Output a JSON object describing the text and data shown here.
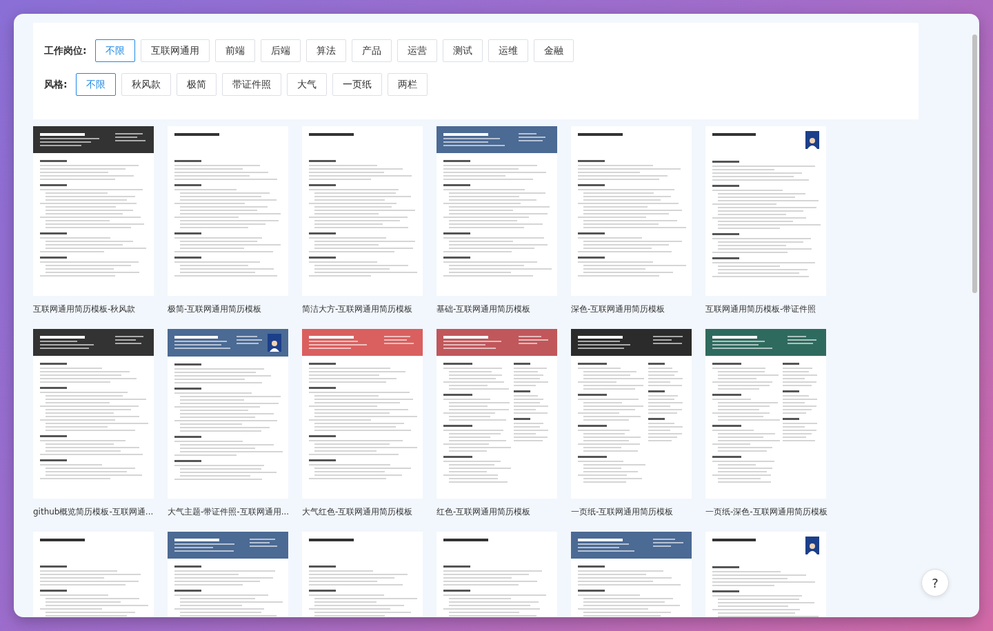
{
  "filters": [
    {
      "label": "工作岗位:",
      "options": [
        {
          "text": "不限",
          "selected": true
        },
        {
          "text": "互联网通用",
          "selected": false
        },
        {
          "text": "前端",
          "selected": false
        },
        {
          "text": "后端",
          "selected": false
        },
        {
          "text": "算法",
          "selected": false
        },
        {
          "text": "产品",
          "selected": false
        },
        {
          "text": "运营",
          "selected": false
        },
        {
          "text": "测试",
          "selected": false
        },
        {
          "text": "运维",
          "selected": false
        },
        {
          "text": "金融",
          "selected": false
        }
      ]
    },
    {
      "label": "风格:",
      "options": [
        {
          "text": "不限",
          "selected": true
        },
        {
          "text": "秋风款",
          "selected": false
        },
        {
          "text": "极简",
          "selected": false
        },
        {
          "text": "带证件照",
          "selected": false
        },
        {
          "text": "大气",
          "selected": false
        },
        {
          "text": "一页纸",
          "selected": false
        },
        {
          "text": "两栏",
          "selected": false
        }
      ]
    }
  ],
  "templates": [
    {
      "title": "互联网通用简历模板-秋风款",
      "kind": "single",
      "color": "#333333",
      "photo": false
    },
    {
      "title": "极简-互联网通用简历模板",
      "kind": "single",
      "photo": false
    },
    {
      "title": "简洁大方-互联网通用简历模板",
      "kind": "single",
      "photo": false
    },
    {
      "title": "基础-互联网通用简历模板",
      "kind": "single",
      "color": "#4b6a94",
      "photo": false
    },
    {
      "title": "深色-互联网通用简历模板",
      "kind": "single",
      "photo": false
    },
    {
      "title": "互联网通用简历模板-带证件照",
      "kind": "single",
      "photo": true
    },
    {
      "title": "github概览简历模板-互联网通...",
      "kind": "single",
      "color": "#333333",
      "photo": false
    },
    {
      "title": "大气主题-带证件照-互联网通用...",
      "kind": "single",
      "color": "#4b6a94",
      "photo": true
    },
    {
      "title": "大气红色-互联网通用简历模板",
      "kind": "single",
      "color": "#d9605f",
      "photo": false
    },
    {
      "title": "红色-互联网通用简历模板",
      "kind": "two-column",
      "color": "#c0575b",
      "photo": false
    },
    {
      "title": "一页纸-互联网通用简历模板",
      "kind": "two-column",
      "color": "#2b2b2b",
      "photo": false
    },
    {
      "title": "一页纸-深色-互联网通用简历模板",
      "kind": "two-column",
      "color": "#2f6a5f",
      "photo": false
    },
    {
      "kind": "single",
      "photo": false
    },
    {
      "kind": "single",
      "color": "#4b6a94",
      "photo": false
    },
    {
      "kind": "single",
      "photo": false
    },
    {
      "kind": "single",
      "photo": false
    },
    {
      "kind": "single",
      "color": "#4b6a94",
      "photo": false
    },
    {
      "kind": "single",
      "photo": true
    }
  ],
  "help_button": {
    "text": "?"
  }
}
